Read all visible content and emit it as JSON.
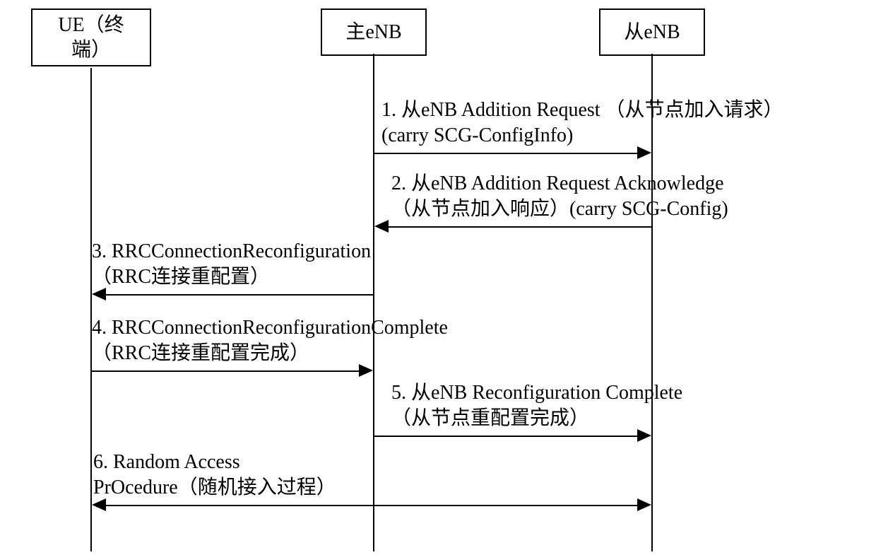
{
  "participants": {
    "ue": {
      "line1": "UE（终",
      "line2": "端）"
    },
    "menb": {
      "label": "主eNB"
    },
    "senb": {
      "label": "从eNB"
    }
  },
  "messages": {
    "m1": {
      "line1": "1. 从eNB Addition Request （从节点加入请求）",
      "line2": "(carry SCG-ConfigInfo)"
    },
    "m2": {
      "line1": "2. 从eNB Addition Request Acknowledge",
      "line2": "（从节点加入响应）(carry SCG-Config)"
    },
    "m3": {
      "line1": "3. RRCConnectionReconfiguration",
      "line2": "（RRC连接重配置）"
    },
    "m4": {
      "line1": "4. RRCConnectionReconfigurationComplete",
      "line2": "（RRC连接重配置完成）"
    },
    "m5": {
      "line1": "5. 从eNB Reconfiguration Complete",
      "line2": "（从节点重配置完成）"
    },
    "m6": {
      "line1": "6. Random Access",
      "line2": "PrOcedure（随机接入过程）"
    }
  },
  "chart_data": {
    "type": "sequence_diagram",
    "participants": [
      "UE（终端）",
      "主eNB",
      "从eNB"
    ],
    "messages": [
      {
        "step": 1,
        "from": "主eNB",
        "to": "从eNB",
        "text": "从eNB Addition Request （从节点加入请求） (carry SCG-ConfigInfo)"
      },
      {
        "step": 2,
        "from": "从eNB",
        "to": "主eNB",
        "text": "从eNB Addition Request Acknowledge （从节点加入响应）(carry SCG-Config)"
      },
      {
        "step": 3,
        "from": "主eNB",
        "to": "UE（终端）",
        "text": "RRCConnectionReconfiguration （RRC连接重配置）"
      },
      {
        "step": 4,
        "from": "UE（终端）",
        "to": "主eNB",
        "text": "RRCConnectionReconfigurationComplete （RRC连接重配置完成）"
      },
      {
        "step": 5,
        "from": "主eNB",
        "to": "从eNB",
        "text": "从eNB Reconfiguration Complete （从节点重配置完成）"
      },
      {
        "step": 6,
        "from": "UE（终端）",
        "to": "从eNB",
        "bidirectional": true,
        "text": "Random Access PrOcedure（随机接入过程）"
      }
    ]
  }
}
